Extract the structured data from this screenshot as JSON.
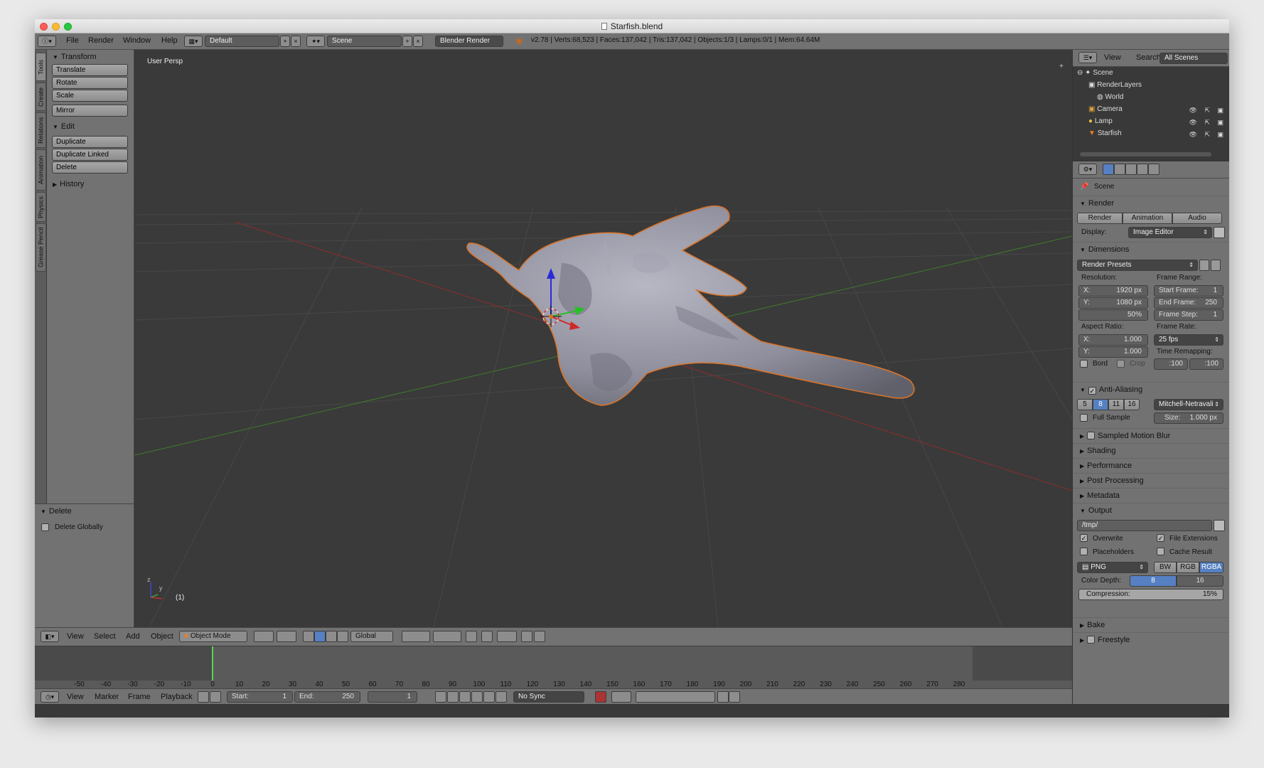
{
  "window": {
    "title": "Starfish.blend"
  },
  "infobar": {
    "menus": [
      "File",
      "Render",
      "Window",
      "Help"
    ],
    "screen_layout": "Default",
    "scene": "Scene",
    "engine": "Blender Render",
    "stats": "v2.78 | Verts:68,523 | Faces:137,042 | Tris:137,042 | Objects:1/3 | Lamps:0/1 | Mem:64.64M"
  },
  "tool_tabs": [
    "Tools",
    "Create",
    "Relations",
    "Animation",
    "Physics",
    "Grease Pencil"
  ],
  "tools": {
    "transform": {
      "title": "Transform",
      "buttons": [
        "Translate",
        "Rotate",
        "Scale",
        "Mirror"
      ]
    },
    "edit": {
      "title": "Edit",
      "buttons": [
        "Duplicate",
        "Duplicate Linked",
        "Delete"
      ]
    },
    "history": {
      "title": "History"
    }
  },
  "operator_panel": {
    "title": "Delete",
    "option": "Delete Globally"
  },
  "viewport": {
    "label": "User Persp",
    "frame_indicator": "(1)",
    "axis_y": "y",
    "axis_z": "z"
  },
  "viewport_header": {
    "menus": [
      "View",
      "Select",
      "Add",
      "Object"
    ],
    "mode": "Object Mode",
    "orientation": "Global"
  },
  "timeline": {
    "ruler_labels": [
      "-50",
      "-40",
      "-30",
      "-20",
      "-10",
      "0",
      "10",
      "20",
      "30",
      "40",
      "50",
      "60",
      "70",
      "80",
      "90",
      "100",
      "110",
      "120",
      "130",
      "140",
      "150",
      "160",
      "170",
      "180",
      "190",
      "200",
      "210",
      "220",
      "230",
      "240",
      "250",
      "260",
      "270",
      "280"
    ],
    "menus": [
      "View",
      "Marker",
      "Frame",
      "Playback"
    ],
    "start_label": "Start:",
    "start_value": "1",
    "end_label": "End:",
    "end_value": "250",
    "current_frame": "1",
    "sync": "No Sync"
  },
  "outliner": {
    "menus": [
      "View",
      "Search"
    ],
    "filter": "All Scenes",
    "items": [
      "Scene",
      "RenderLayers",
      "World",
      "Camera",
      "Lamp",
      "Starfish"
    ]
  },
  "properties": {
    "context": "Scene",
    "render": {
      "title": "Render",
      "buttons": [
        "Render",
        "Animation",
        "Audio"
      ],
      "display_label": "Display:",
      "display_value": "Image Editor"
    },
    "dimensions": {
      "title": "Dimensions",
      "presets": "Render Presets",
      "resolution_label": "Resolution:",
      "res_x_label": "X:",
      "res_x": "1920 px",
      "res_y_label": "Y:",
      "res_y": "1080 px",
      "res_pct": "50%",
      "frame_range_label": "Frame Range:",
      "start_label": "Start Frame:",
      "start": "1",
      "end_label": "End Frame:",
      "end": "250",
      "step_label": "Frame Step:",
      "step": "1",
      "aspect_label": "Aspect Ratio:",
      "asp_x_label": "X:",
      "asp_x": "1.000",
      "asp_y_label": "Y:",
      "asp_y": "1.000",
      "frame_rate_label": "Frame Rate:",
      "frame_rate": "25 fps",
      "remap_label": "Time Remapping:",
      "remap_old": ":100",
      "remap_new": ":100",
      "bord": "Bord",
      "crop": "Crop"
    },
    "anti_aliasing": {
      "title": "Anti-Aliasing",
      "samples": [
        "5",
        "8",
        "11",
        "16"
      ],
      "filter": "Mitchell-Netravali",
      "full_sample": "Full Sample",
      "size_label": "Size:",
      "size": "1.000 px"
    },
    "collapsed_panels": [
      "Sampled Motion Blur",
      "Shading",
      "Performance",
      "Post Processing",
      "Metadata"
    ],
    "output": {
      "title": "Output",
      "path": "/tmp/",
      "overwrite": "Overwrite",
      "file_extensions": "File Extensions",
      "placeholders": "Placeholders",
      "cache_result": "Cache Result",
      "format": "PNG",
      "color_modes": [
        "BW",
        "RGB",
        "RGBA"
      ],
      "color_depth_label": "Color Depth:",
      "depths": [
        "8",
        "16"
      ],
      "compression_label": "Compression:",
      "compression": "15%"
    },
    "bottom_panels": [
      "Bake",
      "Freestyle"
    ]
  }
}
